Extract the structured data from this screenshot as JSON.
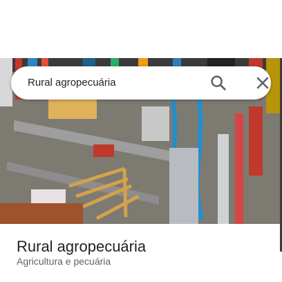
{
  "search": {
    "query": "Rural agropecuária",
    "search_icon": "search-icon",
    "close_icon": "close-icon"
  },
  "place": {
    "name": "Rural agropecuária",
    "category": "Agricultura e pecuária",
    "photo": "store interior with tools, hoses, chains and hardware on shelves"
  },
  "colors": {
    "title": "#202124",
    "subtitle": "#5f6368",
    "icon": "#5f6368"
  }
}
